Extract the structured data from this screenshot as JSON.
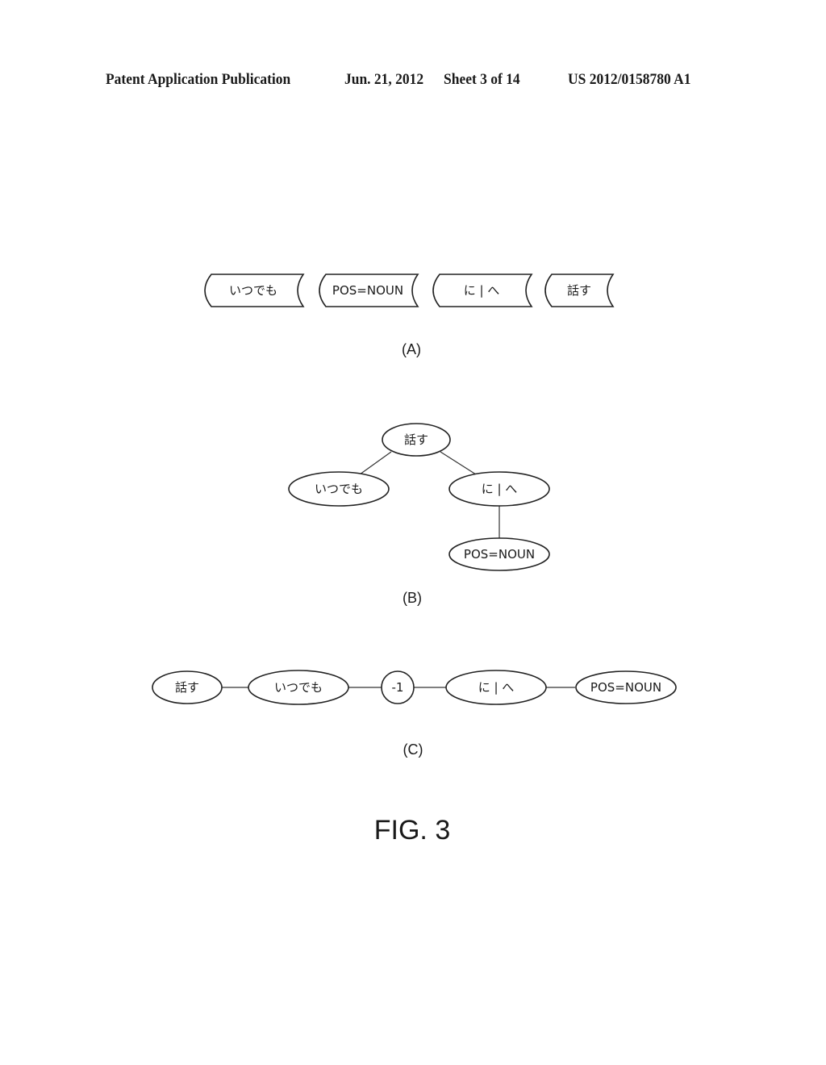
{
  "header": {
    "publication": "Patent Application Publication",
    "date": "Jun. 21, 2012",
    "sheet": "Sheet 3 of 14",
    "number": "US 2012/0158780 A1"
  },
  "panel_a": {
    "label": "(A)",
    "tokens": [
      "いつでも",
      "POS=NOUN",
      "に | へ",
      "話す"
    ]
  },
  "panel_b": {
    "label": "(B)",
    "nodes": {
      "root": "話す",
      "left_child": "いつでも",
      "right_child": "に | へ",
      "grandchild": "POS=NOUN"
    },
    "edges": [
      [
        "root",
        "left_child"
      ],
      [
        "root",
        "right_child"
      ],
      [
        "right_child",
        "grandchild"
      ]
    ]
  },
  "panel_c": {
    "label": "(C)",
    "chain": [
      "話す",
      "いつでも",
      "-1",
      "に | へ",
      "POS=NOUN"
    ]
  },
  "figure_label": "FIG. 3"
}
